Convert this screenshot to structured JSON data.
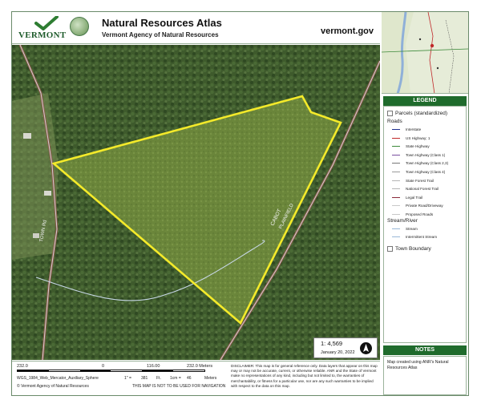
{
  "header": {
    "logo_text": "VERMONT",
    "title": "Natural Resources Atlas",
    "subtitle": "Vermont Agency of Natural Resources",
    "site": "vermont.gov"
  },
  "map": {
    "road_labels": [
      "TOWN Rd",
      "CABOT",
      "PLAINFIELD"
    ],
    "scale_ratio": "1: 4,569",
    "date": "January 20, 2022",
    "colors": {
      "parcel_outline": "#f4ea2a",
      "road_line": "#d0d0d0",
      "stream": "#c8d8e8"
    }
  },
  "scale": {
    "ticks": [
      "232.0",
      "0",
      "116.00",
      "232.0 Meters"
    ],
    "projection": "WGS_1984_Web_Mercator_Auxiliary_Sphere",
    "conversion": [
      "1\" =",
      "381",
      "Ft.",
      "1cm =",
      "46",
      "Meters"
    ],
    "copyright": "© Vermont Agency of Natural Resources",
    "nav_warning": "THIS MAP IS NOT TO BE USED FOR NAVIGATION"
  },
  "disclaimer": "DISCLAIMER: This map is for general reference only. Data layers that appear on this map may or may not be accurate, current, or otherwise reliable. ANR and the State of Vermont make no representations of any kind, including but not limited to, the warranties of merchantability, or fitness for a particular use, nor are any such warranties to be implied with respect to the data on this map.",
  "legend": {
    "title": "LEGEND",
    "parcels": "Parcels (standardized)",
    "roads_heading": "Roads",
    "roads": [
      {
        "label": "Interstate",
        "color": "#1e2f8f"
      },
      {
        "label": "US Highway; 1",
        "color": "#c0282a"
      },
      {
        "label": "State Highway",
        "color": "#3d8a3a"
      },
      {
        "label": "Town Highway (Class 1)",
        "color": "#7a4ea0"
      },
      {
        "label": "Town Highway (Class 2,3)",
        "color": "#777777"
      },
      {
        "label": "Town Highway (Class 4)",
        "color": "#9a9a9a"
      },
      {
        "label": "State Forest Trail",
        "color": "#b5b5b5"
      },
      {
        "label": "National Forest Trail",
        "color": "#b5b5b5"
      },
      {
        "label": "Legal Trail",
        "color": "#8a2a3a"
      },
      {
        "label": "Private Road/Driveway",
        "color": "#c8c8c8"
      },
      {
        "label": "Proposed Roads",
        "color": "#c8c8c8"
      }
    ],
    "stream_heading": "Stream/River",
    "streams": [
      {
        "label": "Stream",
        "color": "#9ab8d8"
      },
      {
        "label": "Intermittent Stream",
        "color": "#9ab8d8"
      }
    ],
    "town_boundary": "Town Boundary"
  },
  "notes": {
    "title": "NOTES",
    "text": "Map created using ANR's Natural Resources Atlas"
  }
}
